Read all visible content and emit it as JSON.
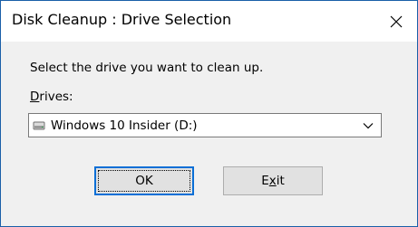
{
  "window": {
    "title": "Disk Cleanup : Drive Selection",
    "close_icon": "close-icon"
  },
  "dialog": {
    "prompt": "Select the drive you want to clean up.",
    "drives_label_accel": "D",
    "drives_label_rest": "rives:",
    "selected_drive": "Windows 10 Insider (D:)",
    "drive_icon": "drive-icon",
    "dropdown_icon": "chevron-down-icon"
  },
  "buttons": {
    "ok": "OK",
    "exit_before": "E",
    "exit_accel": "x",
    "exit_after": "it"
  }
}
